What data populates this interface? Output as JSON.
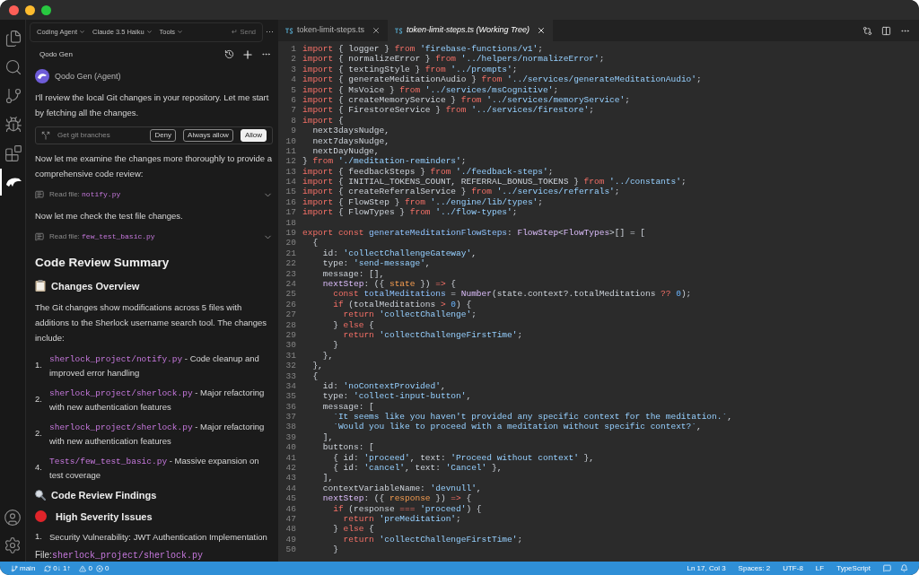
{
  "activity_bar": {
    "items": [
      {
        "kind": "files",
        "selected": false
      },
      {
        "kind": "search",
        "selected": false
      },
      {
        "kind": "source-control",
        "selected": false
      },
      {
        "kind": "run",
        "selected": false
      },
      {
        "kind": "extensions",
        "selected": false
      },
      {
        "kind": "agent",
        "selected": true
      }
    ]
  },
  "chat": {
    "toolbar": {
      "mode": "Coding Agent",
      "model": "Claude 3.5 Haiku",
      "tools": "Tools",
      "send": "↵ Send",
      "more": "···"
    },
    "header": {
      "title": "Qodo Gen"
    },
    "blocks": [
      {
        "kind": "agent",
        "text": "Qodo Gen (Agent)"
      },
      {
        "kind": "p",
        "text": "I'll review the local Git changes in your repository. Let me start by fetching all the changes."
      },
      {
        "kind": "tool",
        "text": "Get git branches",
        "buttons": [
          {
            "label": "Deny",
            "selected": false
          },
          {
            "label": "Always allow",
            "selected": false
          },
          {
            "label": "Allow",
            "selected": true
          }
        ]
      },
      {
        "kind": "p",
        "text": "Now let me examine the changes more thoroughly to provide a comprehensive code review:"
      },
      {
        "kind": "read",
        "text": "Read file:",
        "file": "notify.py"
      },
      {
        "kind": "p",
        "text": "Now let me check the test file changes."
      },
      {
        "kind": "read",
        "text": "Read file:",
        "file": "few_test_basic.py"
      },
      {
        "kind": "h1",
        "text": "Code Review Summary"
      },
      {
        "kind": "overview",
        "text": "Changes Overview"
      },
      {
        "kind": "p",
        "text": "The Git changes show modifications across 5 files with additions to the Sherlock username search tool. The changes include:"
      },
      {
        "kind": "li",
        "number": "1.",
        "code": "sherlock_project/notify.py",
        "text": " - Code cleanup and improved error handling"
      },
      {
        "kind": "li",
        "number": "2.",
        "code": "sherlock_project/sherlock.py",
        "text": " - Major refactoring with new authentication features"
      },
      {
        "kind": "li",
        "number": "2.",
        "code": "sherlock_project/sherlock.py",
        "text": " - Major refactoring with new authentication features"
      },
      {
        "kind": "li",
        "number": "4.",
        "code": "Tests/few_test_basic.py",
        "text": " - Massive expansion on test coverage"
      },
      {
        "kind": "findings",
        "text": "Code Review Findings"
      },
      {
        "kind": "issues",
        "text": "High Severity Issues"
      },
      {
        "kind": "li",
        "number": "1.",
        "text": "Security Vulnerability: JWT Authentication Implementation"
      },
      {
        "kind": "file",
        "text": "File:",
        "code": "sherlock_project/sherlock.py"
      }
    ]
  },
  "tabs": [
    {
      "label": "token-limit-steps.ts",
      "selected": false
    },
    {
      "label": "token-limit-steps.ts (Working Tree)",
      "selected": true
    }
  ],
  "editor": {
    "lines": [
      {
        "number": "1",
        "tokens": [
          {
            "kind": "k",
            "text": "import"
          },
          {
            "kind": "p",
            "text": " { logger } "
          },
          {
            "kind": "k",
            "text": "from"
          },
          {
            "kind": "s",
            "text": " 'firebase-functions/v1'"
          },
          {
            "kind": "p",
            "text": ";"
          }
        ]
      },
      {
        "number": "2",
        "tokens": [
          {
            "kind": "k",
            "text": "import"
          },
          {
            "kind": "p",
            "text": " { normalizeError } "
          },
          {
            "kind": "k",
            "text": "from"
          },
          {
            "kind": "s",
            "text": " '../helpers/normalizeError'"
          },
          {
            "kind": "p",
            "text": ";"
          }
        ]
      },
      {
        "number": "3",
        "tokens": [
          {
            "kind": "k",
            "text": "import"
          },
          {
            "kind": "p",
            "text": " { textingStyle } "
          },
          {
            "kind": "k",
            "text": "from"
          },
          {
            "kind": "s",
            "text": " '../prompts'"
          },
          {
            "kind": "p",
            "text": ";"
          }
        ]
      },
      {
        "number": "4",
        "tokens": [
          {
            "kind": "k",
            "text": "import"
          },
          {
            "kind": "p",
            "text": " { generateMeditationAudio } "
          },
          {
            "kind": "k",
            "text": "from"
          },
          {
            "kind": "s",
            "text": " '../services/generateMeditationAudio'"
          },
          {
            "kind": "p",
            "text": ";"
          }
        ]
      },
      {
        "number": "5",
        "tokens": [
          {
            "kind": "k",
            "text": "import"
          },
          {
            "kind": "p",
            "text": " { MsVoice } "
          },
          {
            "kind": "k",
            "text": "from"
          },
          {
            "kind": "s",
            "text": " '../services/msCognitive'"
          },
          {
            "kind": "p",
            "text": ";"
          }
        ]
      },
      {
        "number": "6",
        "tokens": [
          {
            "kind": "k",
            "text": "import"
          },
          {
            "kind": "p",
            "text": " { createMemoryService } "
          },
          {
            "kind": "k",
            "text": "from"
          },
          {
            "kind": "s",
            "text": " '../services/memoryService'"
          },
          {
            "kind": "p",
            "text": ";"
          }
        ]
      },
      {
        "number": "7",
        "tokens": [
          {
            "kind": "k",
            "text": "import"
          },
          {
            "kind": "p",
            "text": " { FirestoreService } "
          },
          {
            "kind": "k",
            "text": "from"
          },
          {
            "kind": "s",
            "text": " '../services/firestore'"
          },
          {
            "kind": "p",
            "text": ";"
          }
        ]
      },
      {
        "number": "8",
        "tokens": [
          {
            "kind": "k",
            "text": "import"
          },
          {
            "kind": "p",
            "text": " {"
          }
        ]
      },
      {
        "number": "9",
        "tokens": [
          {
            "kind": "p",
            "text": "  next3daysNudge,"
          }
        ]
      },
      {
        "number": "10",
        "tokens": [
          {
            "kind": "p",
            "text": "  next7daysNudge,"
          }
        ]
      },
      {
        "number": "11",
        "tokens": [
          {
            "kind": "p",
            "text": "  nextDayNudge,"
          }
        ]
      },
      {
        "number": "12",
        "tokens": [
          {
            "kind": "p",
            "text": "} "
          },
          {
            "kind": "k",
            "text": "from"
          },
          {
            "kind": "s",
            "text": " './meditation-reminders'"
          },
          {
            "kind": "p",
            "text": ";"
          }
        ]
      },
      {
        "number": "13",
        "tokens": [
          {
            "kind": "k",
            "text": "import"
          },
          {
            "kind": "p",
            "text": " { feedbackSteps } "
          },
          {
            "kind": "k",
            "text": "from"
          },
          {
            "kind": "s",
            "text": " './feedback-steps'"
          },
          {
            "kind": "p",
            "text": ";"
          }
        ]
      },
      {
        "number": "14",
        "tokens": [
          {
            "kind": "k",
            "text": "import"
          },
          {
            "kind": "p",
            "text": " { INITIAL_TOKENS_COUNT, REFERRAL_BONUS_TOKENS } "
          },
          {
            "kind": "k",
            "text": "from"
          },
          {
            "kind": "s",
            "text": " '../constants'"
          },
          {
            "kind": "p",
            "text": ";"
          }
        ]
      },
      {
        "number": "15",
        "tokens": [
          {
            "kind": "k",
            "text": "import"
          },
          {
            "kind": "p",
            "text": " { createReferralService } "
          },
          {
            "kind": "k",
            "text": "from"
          },
          {
            "kind": "s",
            "text": " '../services/referrals'"
          },
          {
            "kind": "p",
            "text": ";"
          }
        ]
      },
      {
        "number": "16",
        "tokens": [
          {
            "kind": "k",
            "text": "import"
          },
          {
            "kind": "p",
            "text": " { FlowStep } "
          },
          {
            "kind": "k",
            "text": "from"
          },
          {
            "kind": "s",
            "text": " '../engine/lib/types'"
          },
          {
            "kind": "p",
            "text": ";"
          }
        ]
      },
      {
        "number": "17",
        "tokens": [
          {
            "kind": "k",
            "text": "import"
          },
          {
            "kind": "p",
            "text": " { FlowTypes } "
          },
          {
            "kind": "k",
            "text": "from"
          },
          {
            "kind": "s",
            "text": " '../flow-types'"
          },
          {
            "kind": "p",
            "text": ";"
          }
        ]
      },
      {
        "number": "18"
      },
      {
        "number": "19",
        "tokens": [
          {
            "kind": "k",
            "text": "export const"
          },
          {
            "kind": "d",
            "text": " generateMeditationFlowSteps"
          },
          {
            "kind": "p",
            "text": ": "
          },
          {
            "kind": "t",
            "text": "FlowStep"
          },
          {
            "kind": "p",
            "text": "<"
          },
          {
            "kind": "t",
            "text": "FlowTypes"
          },
          {
            "kind": "p",
            "text": ">[] = ["
          }
        ]
      },
      {
        "number": "20",
        "tokens": [
          {
            "kind": "p",
            "text": "  {"
          }
        ]
      },
      {
        "number": "21",
        "tokens": [
          {
            "kind": "p",
            "text": "    id: "
          },
          {
            "kind": "s",
            "text": "'collectChallengeGateway'"
          },
          {
            "kind": "p",
            "text": ","
          }
        ]
      },
      {
        "number": "22",
        "tokens": [
          {
            "kind": "p",
            "text": "    type: "
          },
          {
            "kind": "s",
            "text": "'send-message'"
          },
          {
            "kind": "p",
            "text": ","
          }
        ]
      },
      {
        "number": "23",
        "tokens": [
          {
            "kind": "p",
            "text": "    message: [],"
          }
        ]
      },
      {
        "number": "24",
        "tokens": [
          {
            "kind": "t",
            "text": "    nextStep"
          },
          {
            "kind": "p",
            "text": ": ({ "
          },
          {
            "kind": "v",
            "text": "state"
          },
          {
            "kind": "p",
            "text": " }) "
          },
          {
            "kind": "k",
            "text": "=>"
          },
          {
            "kind": "p",
            "text": " {"
          }
        ]
      },
      {
        "number": "25",
        "tokens": [
          {
            "kind": "k",
            "text": "      const"
          },
          {
            "kind": "d",
            "text": " totalMeditations"
          },
          {
            "kind": "p",
            "text": " = "
          },
          {
            "kind": "t",
            "text": "Number"
          },
          {
            "kind": "p",
            "text": "(state.context?.totalMeditations "
          },
          {
            "kind": "k",
            "text": "??"
          },
          {
            "kind": "n",
            "text": " 0"
          },
          {
            "kind": "p",
            "text": ");"
          }
        ]
      },
      {
        "number": "26",
        "tokens": [
          {
            "kind": "k",
            "text": "      if"
          },
          {
            "kind": "p",
            "text": " (totalMeditations "
          },
          {
            "kind": "k",
            "text": ">"
          },
          {
            "kind": "n",
            "text": " 0"
          },
          {
            "kind": "p",
            "text": ") {"
          }
        ]
      },
      {
        "number": "27",
        "tokens": [
          {
            "kind": "k",
            "text": "        return"
          },
          {
            "kind": "s",
            "text": " 'collectChallenge'"
          },
          {
            "kind": "p",
            "text": ";"
          }
        ]
      },
      {
        "number": "28",
        "tokens": [
          {
            "kind": "p",
            "text": "      } "
          },
          {
            "kind": "k",
            "text": "else"
          },
          {
            "kind": "p",
            "text": " {"
          }
        ]
      },
      {
        "number": "29",
        "tokens": [
          {
            "kind": "k",
            "text": "        return"
          },
          {
            "kind": "s",
            "text": " 'collectChallengeFirstTime'"
          },
          {
            "kind": "p",
            "text": ";"
          }
        ]
      },
      {
        "number": "30",
        "tokens": [
          {
            "kind": "p",
            "text": "      }"
          }
        ]
      },
      {
        "number": "31",
        "tokens": [
          {
            "kind": "p",
            "text": "    },"
          }
        ]
      },
      {
        "number": "32",
        "tokens": [
          {
            "kind": "p",
            "text": "  },"
          }
        ]
      },
      {
        "number": "33",
        "tokens": [
          {
            "kind": "p",
            "text": "  {"
          }
        ]
      },
      {
        "number": "34",
        "tokens": [
          {
            "kind": "p",
            "text": "    id: "
          },
          {
            "kind": "s",
            "text": "'noContextProvided'"
          },
          {
            "kind": "p",
            "text": ","
          }
        ]
      },
      {
        "number": "35",
        "tokens": [
          {
            "kind": "p",
            "text": "    type: "
          },
          {
            "kind": "s",
            "text": "'collect-input-button'"
          },
          {
            "kind": "p",
            "text": ","
          }
        ]
      },
      {
        "number": "36",
        "tokens": [
          {
            "kind": "p",
            "text": "    message: ["
          }
        ]
      },
      {
        "number": "37",
        "tokens": [
          {
            "kind": "s",
            "text": "      `It seems like you haven't provided any specific context for the meditation.`"
          },
          {
            "kind": "p",
            "text": ","
          }
        ]
      },
      {
        "number": "38",
        "tokens": [
          {
            "kind": "s",
            "text": "      `Would you like to proceed with a meditation without specific context?`"
          },
          {
            "kind": "p",
            "text": ","
          }
        ]
      },
      {
        "number": "39",
        "tokens": [
          {
            "kind": "p",
            "text": "    ],"
          }
        ]
      },
      {
        "number": "40",
        "tokens": [
          {
            "kind": "p",
            "text": "    buttons: ["
          }
        ]
      },
      {
        "number": "41",
        "tokens": [
          {
            "kind": "p",
            "text": "      { id: "
          },
          {
            "kind": "s",
            "text": "'proceed'"
          },
          {
            "kind": "p",
            "text": ", text: "
          },
          {
            "kind": "s",
            "text": "'Proceed without context'"
          },
          {
            "kind": "p",
            "text": " },"
          }
        ]
      },
      {
        "number": "42",
        "tokens": [
          {
            "kind": "p",
            "text": "      { id: "
          },
          {
            "kind": "s",
            "text": "'cancel'"
          },
          {
            "kind": "p",
            "text": ", text: "
          },
          {
            "kind": "s",
            "text": "'Cancel'"
          },
          {
            "kind": "p",
            "text": " },"
          }
        ]
      },
      {
        "number": "43",
        "tokens": [
          {
            "kind": "p",
            "text": "    ],"
          }
        ]
      },
      {
        "number": "44",
        "tokens": [
          {
            "kind": "p",
            "text": "    contextVariableName: "
          },
          {
            "kind": "s",
            "text": "'devnull'"
          },
          {
            "kind": "p",
            "text": ","
          }
        ]
      },
      {
        "number": "45",
        "tokens": [
          {
            "kind": "t",
            "text": "    nextStep"
          },
          {
            "kind": "p",
            "text": ": ({ "
          },
          {
            "kind": "v",
            "text": "response"
          },
          {
            "kind": "p",
            "text": " }) "
          },
          {
            "kind": "k",
            "text": "=>"
          },
          {
            "kind": "p",
            "text": " {"
          }
        ]
      },
      {
        "number": "46",
        "tokens": [
          {
            "kind": "k",
            "text": "      if"
          },
          {
            "kind": "p",
            "text": " (response "
          },
          {
            "kind": "k",
            "text": "==="
          },
          {
            "kind": "s",
            "text": " 'proceed'"
          },
          {
            "kind": "p",
            "text": ") {"
          }
        ]
      },
      {
        "number": "47",
        "tokens": [
          {
            "kind": "k",
            "text": "        return"
          },
          {
            "kind": "s",
            "text": " 'preMeditation'"
          },
          {
            "kind": "p",
            "text": ";"
          }
        ]
      },
      {
        "number": "48",
        "tokens": [
          {
            "kind": "p",
            "text": "      } "
          },
          {
            "kind": "k",
            "text": "else"
          },
          {
            "kind": "p",
            "text": " {"
          }
        ]
      },
      {
        "number": "49",
        "tokens": [
          {
            "kind": "k",
            "text": "        return"
          },
          {
            "kind": "s",
            "text": " 'collectChallengeFirstTime'"
          },
          {
            "kind": "p",
            "text": ";"
          }
        ]
      },
      {
        "number": "50",
        "tokens": [
          {
            "kind": "p",
            "text": "      }"
          }
        ]
      }
    ]
  },
  "status_bar": {
    "branch": "main",
    "sync": "0↓ 1↑",
    "warnings": "0",
    "errors": "0",
    "right": [
      "Ln 17, Col 3",
      "Spaces: 2",
      "UTF-8",
      "LF",
      "TypeScript"
    ]
  }
}
